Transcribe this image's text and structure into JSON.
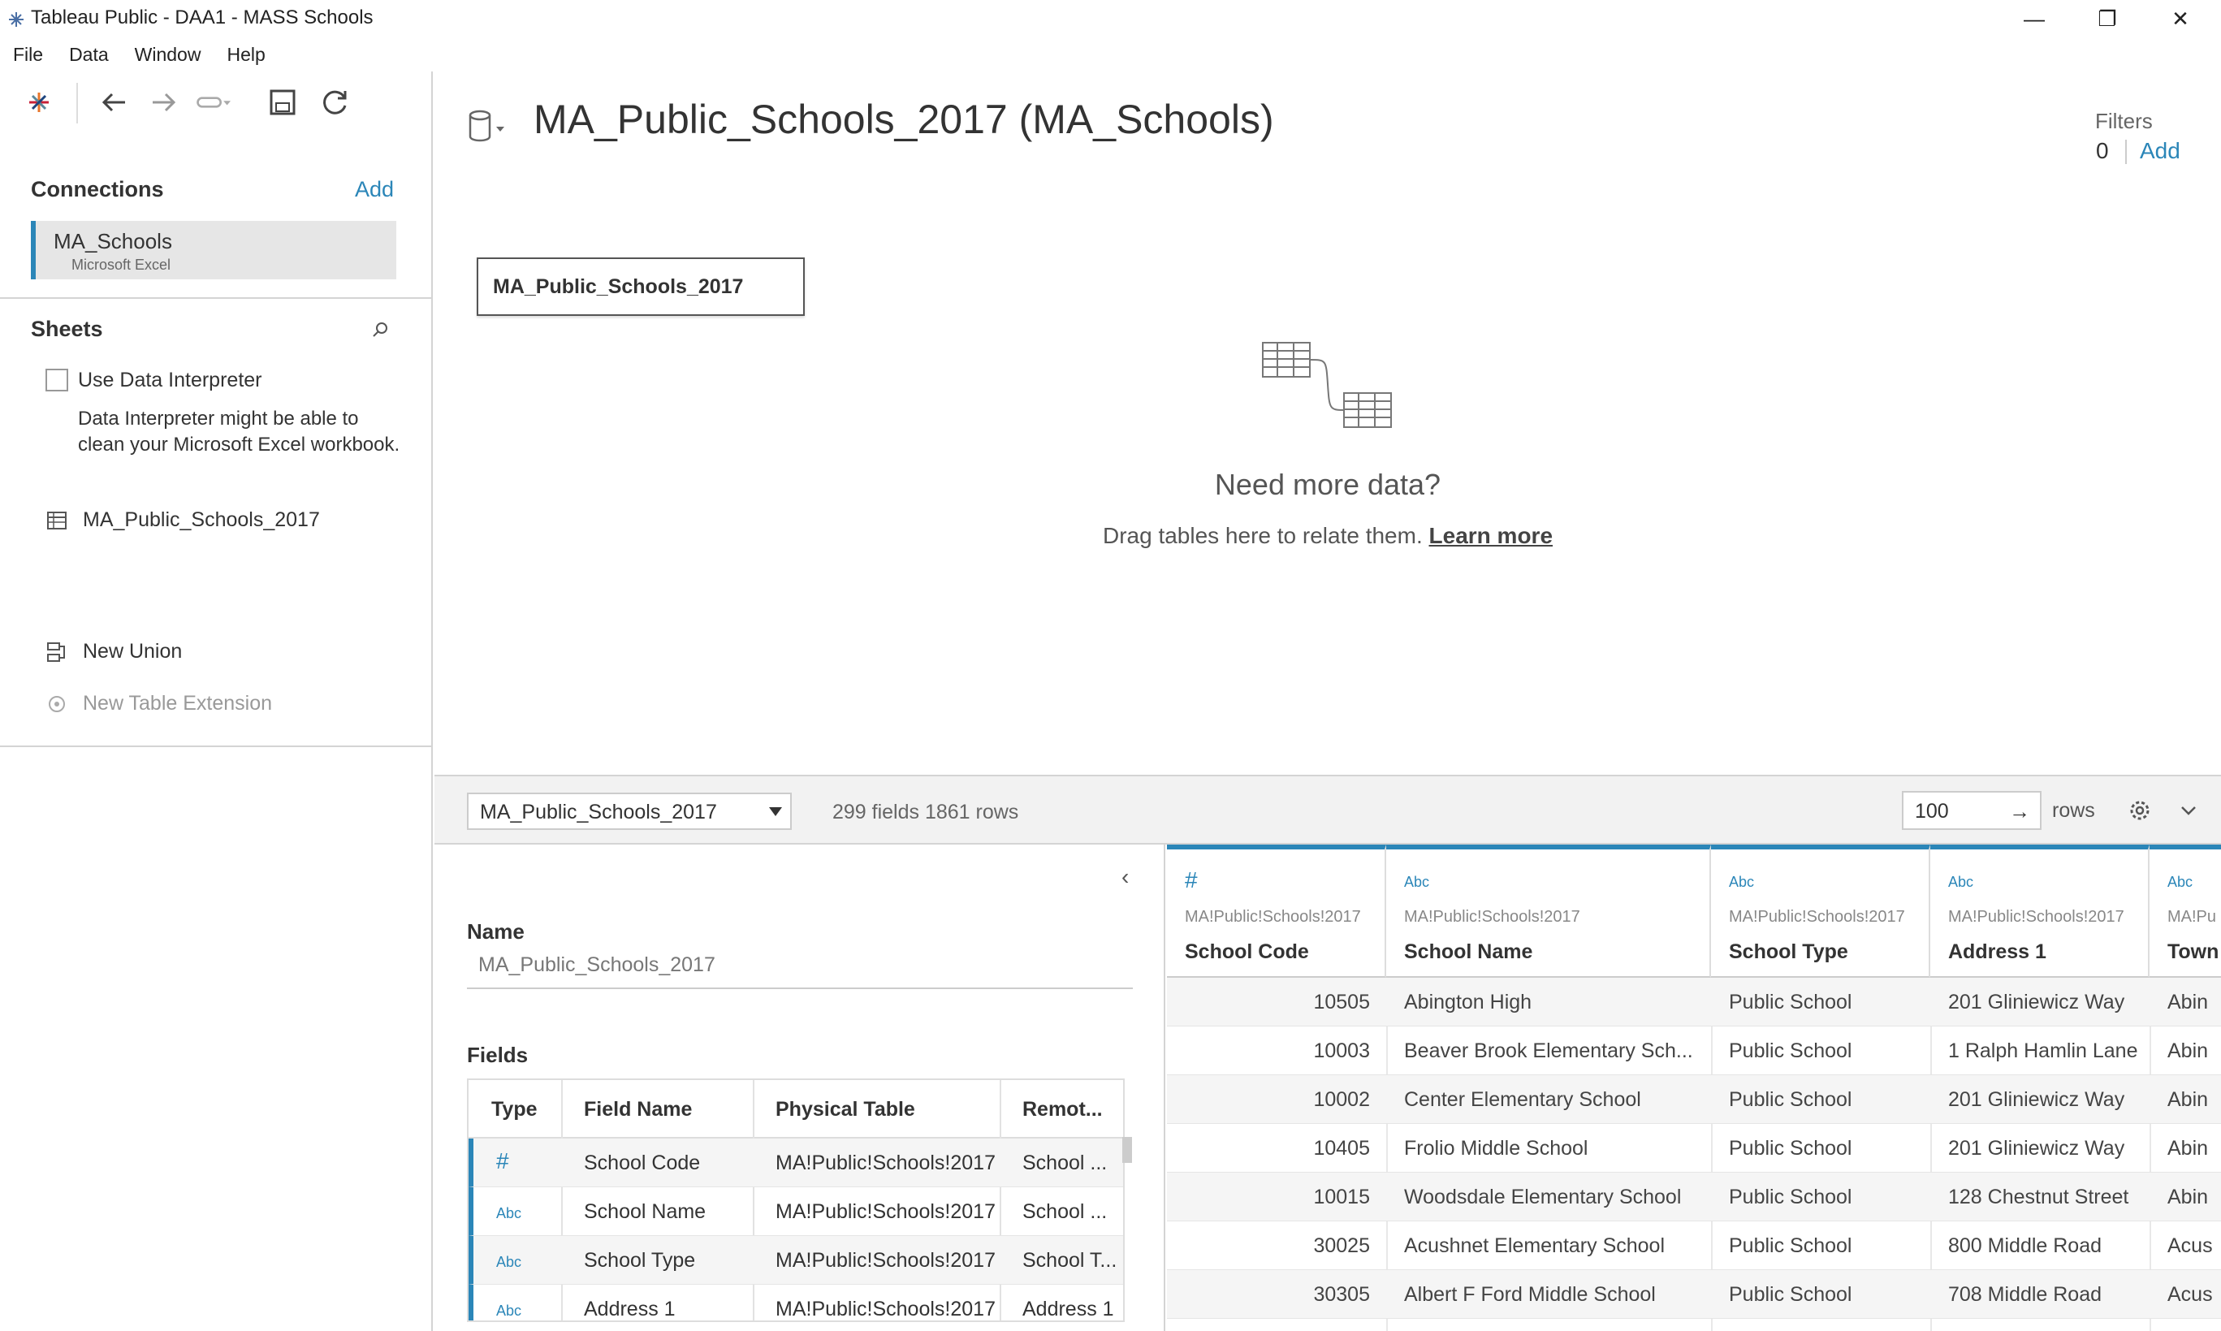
{
  "window": {
    "title": "Tableau Public - DAA1 - MASS Schools",
    "minimize": "—",
    "restore": "❐",
    "close": "✕"
  },
  "menu": [
    "File",
    "Data",
    "Window",
    "Help"
  ],
  "left": {
    "connections_title": "Connections",
    "connections_add": "Add",
    "connection": {
      "name": "MA_Schools",
      "type": "Microsoft Excel"
    },
    "sheets_title": "Sheets",
    "use_interpreter": "Use Data Interpreter",
    "interpreter_help": "Data Interpreter might be able to clean your Microsoft Excel workbook.",
    "sheet_item": "MA_Public_Schools_2017",
    "new_union": "New Union",
    "new_table_extension": "New Table Extension"
  },
  "canvas": {
    "datasource_title": "MA_Public_Schools_2017 (MA_Schools)",
    "filters_label": "Filters",
    "filters_count": "0",
    "filters_add": "Add",
    "table_name": "MA_Public_Schools_2017",
    "need_more": "Need more data?",
    "drag_text": "Drag tables here to relate them.",
    "learn_more": "Learn more"
  },
  "gridbar": {
    "table_select": "MA_Public_Schools_2017",
    "fields_rows": "299 fields 1861 rows",
    "rows_value": "100",
    "rows_label": "rows"
  },
  "meta": {
    "name_label": "Name",
    "name_value": "MA_Public_Schools_2017",
    "fields_label": "Fields",
    "headers": [
      "Type",
      "Field Name",
      "Physical Table",
      "Remot..."
    ],
    "rows": [
      {
        "type": "#",
        "field": "School Code",
        "table": "MA!Public!Schools!2017",
        "remote": "School ..."
      },
      {
        "type": "Abc",
        "field": "School Name",
        "table": "MA!Public!Schools!2017",
        "remote": "School ..."
      },
      {
        "type": "Abc",
        "field": "School Type",
        "table": "MA!Public!Schools!2017",
        "remote": "School T..."
      },
      {
        "type": "Abc",
        "field": "Address 1",
        "table": "MA!Public!Schools!2017",
        "remote": "Address 1"
      }
    ]
  },
  "grid": {
    "columns": [
      {
        "type": "#",
        "source": "MA!Public!Schools!2017",
        "name": "School Code"
      },
      {
        "type": "Abc",
        "source": "MA!Public!Schools!2017",
        "name": "School Name"
      },
      {
        "type": "Abc",
        "source": "MA!Public!Schools!2017",
        "name": "School Type"
      },
      {
        "type": "Abc",
        "source": "MA!Public!Schools!2017",
        "name": "Address 1"
      },
      {
        "type": "Abc",
        "source": "MA!Pu",
        "name": "Town"
      }
    ],
    "rows": [
      [
        "10505",
        "Abington High",
        "Public School",
        "201 Gliniewicz Way",
        "Abin"
      ],
      [
        "10003",
        "Beaver Brook Elementary Sch...",
        "Public School",
        "1 Ralph Hamlin Lane",
        "Abin"
      ],
      [
        "10002",
        "Center Elementary School",
        "Public School",
        "201 Gliniewicz Way",
        "Abin"
      ],
      [
        "10405",
        "Frolio Middle School",
        "Public School",
        "201 Gliniewicz Way",
        "Abin"
      ],
      [
        "10015",
        "Woodsdale Elementary School",
        "Public School",
        "128 Chestnut Street",
        "Abin"
      ],
      [
        "30025",
        "Acushnet Elementary School",
        "Public School",
        "800 Middle Road",
        "Acus"
      ],
      [
        "30305",
        "Albert F Ford Middle School",
        "Public School",
        "708 Middle Road",
        "Acus"
      ]
    ]
  },
  "colors": {
    "accent": "#2b86b8",
    "border": "#d4d4d4"
  }
}
